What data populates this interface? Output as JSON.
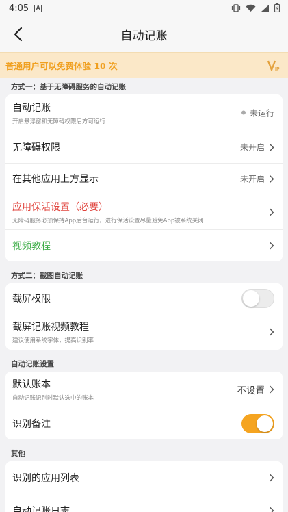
{
  "status_bar": {
    "time": "4:05",
    "notif_letter": "A"
  },
  "header": {
    "title": "自动记账"
  },
  "banner": {
    "text": "普通用户可以免费体验 10 次",
    "vip_label": "VIP"
  },
  "section1": {
    "label": "方式一：基于无障碍服务的自动记账",
    "auto_title": "自动记账",
    "auto_sub": "开启悬浮窗和无障碍权限后方可运行",
    "auto_status": "未运行",
    "access_title": "无障碍权限",
    "access_status": "未开启",
    "overlay_title": "在其他应用上方显示",
    "overlay_status": "未开启",
    "keepalive_title": "应用保活设置（必要）",
    "keepalive_sub": "无障碍服务必须保持App后台运行，进行保活设置尽量避免App被系统关闭",
    "video_title": "视频教程"
  },
  "section2": {
    "label": "方式二：截图自动记账",
    "screen_title": "截屏权限",
    "screen_on": false,
    "tutorial_title": "截屏记账视频教程",
    "tutorial_sub": "建议使用系统字体，提高识别率"
  },
  "section3": {
    "label": "自动记账设置",
    "book_title": "默认账本",
    "book_sub": "自动记账识别时默认选中的账本",
    "book_value": "不设置",
    "note_title": "识别备注",
    "note_on": true
  },
  "section4": {
    "label": "其他",
    "apps_title": "识别的应用列表",
    "log_title": "自动记账日志"
  },
  "colors": {
    "accent": "#f5a420",
    "banner_bg": "#fbe8c8",
    "warn_red": "#e0433c",
    "link_green": "#3fae49"
  }
}
